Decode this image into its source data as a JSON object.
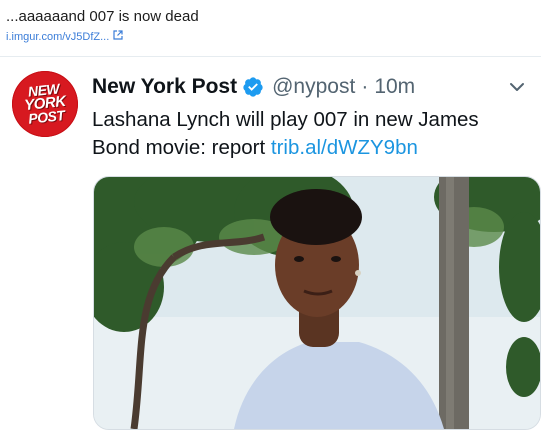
{
  "post": {
    "caption": "...aaaaaand 007 is now dead",
    "link": "i.imgur.com/vJ5DfZ..."
  },
  "tweet": {
    "avatar_lines": [
      "NEW",
      "YORK",
      "POST"
    ],
    "name": "New York Post",
    "handle": "@nypost",
    "separator": "·",
    "time": "10m",
    "text": "Lashana Lynch will play 007 in new James Bond movie: report ",
    "link": "trib.al/dWZY9bn",
    "icons": {
      "verified": "verified-badge-icon",
      "more": "chevron-down-icon",
      "external": "external-link-icon"
    },
    "colors": {
      "verified": "#1d9bf0",
      "link": "#1b95e0",
      "brand": "#d71920"
    }
  }
}
